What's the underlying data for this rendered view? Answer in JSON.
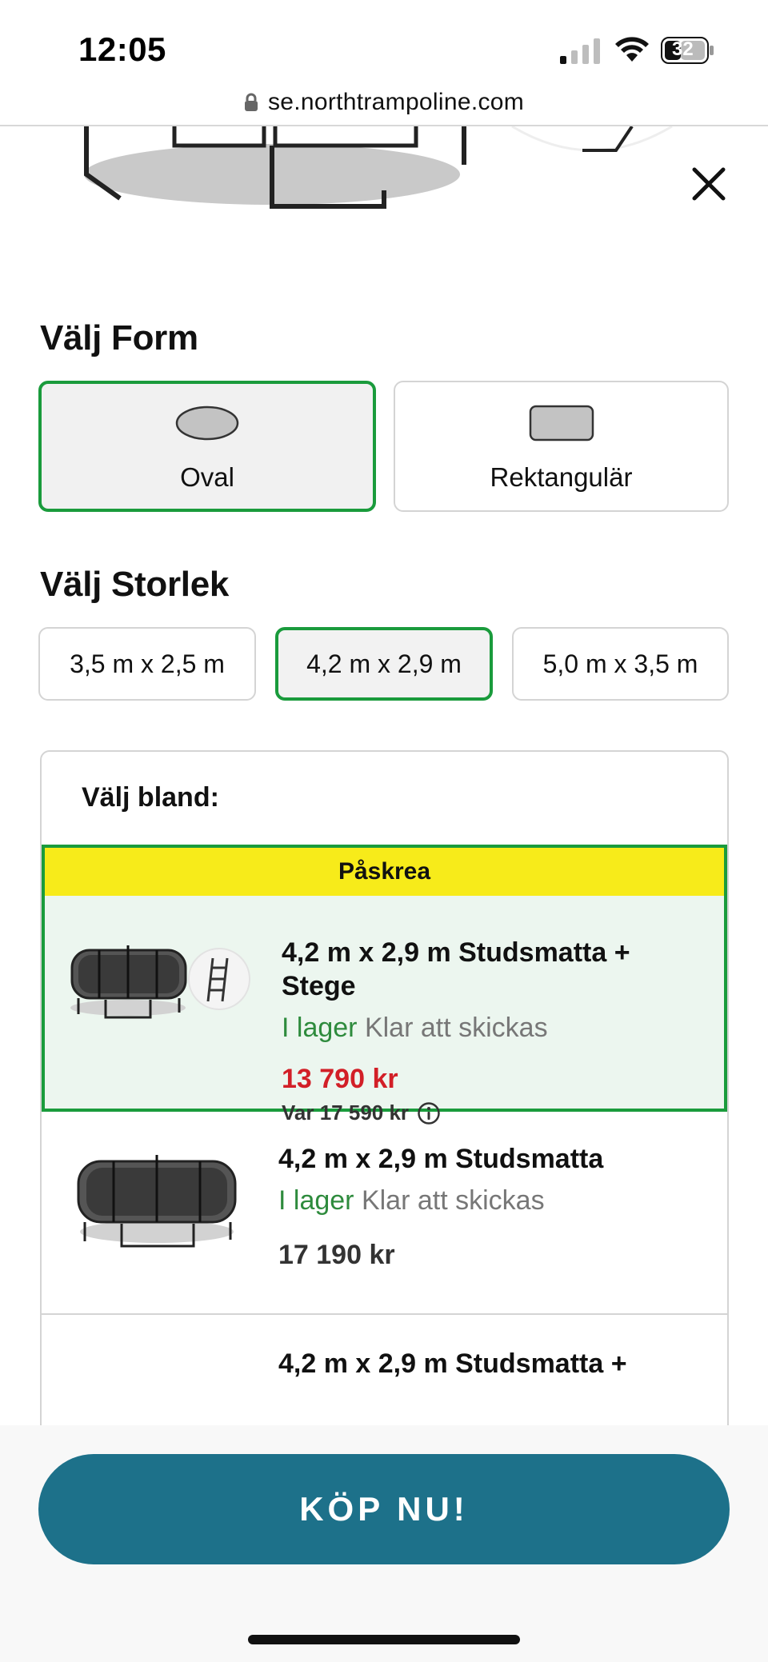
{
  "status_bar": {
    "time": "12:05",
    "battery_level": "32",
    "url": "se.northtrampoline.com"
  },
  "icons": {
    "lock": "lock-icon",
    "close": "close-icon",
    "info": "info-icon"
  },
  "form": {
    "title": "Välj Form",
    "options": [
      {
        "label": "Oval",
        "selected": true
      },
      {
        "label": "Rektangulär",
        "selected": false
      }
    ]
  },
  "size": {
    "title": "Välj Storlek",
    "options": [
      {
        "label": "3,5 m x 2,5 m",
        "selected": false
      },
      {
        "label": "4,2 m x 2,9 m",
        "selected": true
      },
      {
        "label": "5,0 m x 3,5 m",
        "selected": false
      }
    ]
  },
  "variants": {
    "title": "Välj bland:",
    "items": [
      {
        "badge": "Påskrea",
        "name_line1": "4,2 m x 2,9 m Studsmatta +",
        "name_line2": "Stege",
        "stock": "I lager",
        "shipping": "Klar att skickas",
        "price": "13 790 kr",
        "was_price": "Var 17 590 kr",
        "selected": true
      },
      {
        "name_line1": "4,2 m x 2,9 m Studsmatta",
        "stock": "I lager",
        "shipping": "Klar att skickas",
        "price": "17 190 kr",
        "selected": false
      },
      {
        "name_line1": "4,2 m x 2,9 m Studsmatta +"
      }
    ]
  },
  "cta": {
    "label": "KÖP NU!"
  },
  "colors": {
    "selected_border": "#1a9b3c",
    "promo_band": "#f7eb1a",
    "sale_price": "#d21f27",
    "in_stock": "#2e8b3d",
    "cta_background": "#1d718a"
  }
}
